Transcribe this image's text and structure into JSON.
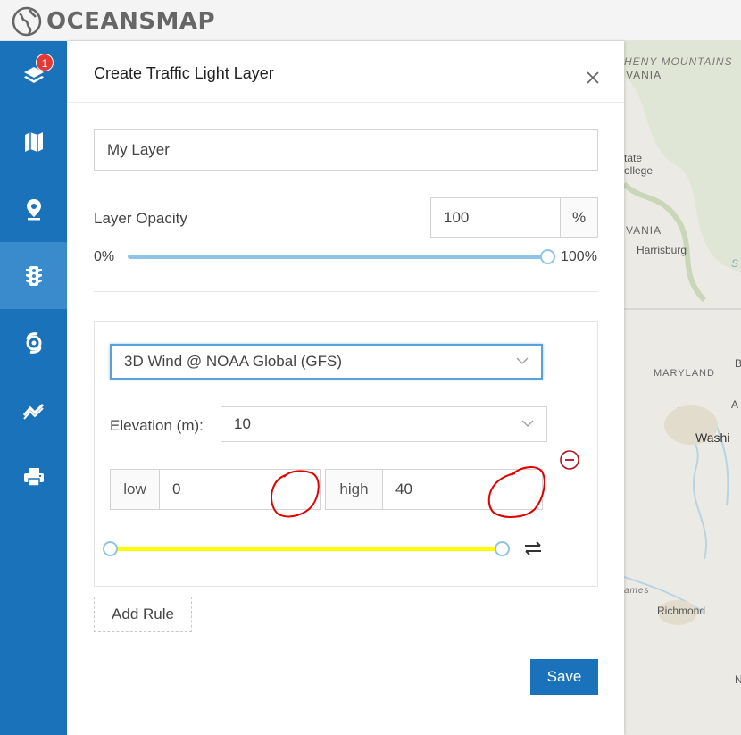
{
  "app": {
    "brand": "OCEANSMAP"
  },
  "sidebar": {
    "items": [
      {
        "icon": "layers-icon",
        "badge": "1"
      },
      {
        "icon": "map-icon"
      },
      {
        "icon": "location-pin-icon"
      },
      {
        "icon": "traffic-light-icon",
        "active": true
      },
      {
        "icon": "hurricane-icon"
      },
      {
        "icon": "trend-chart-icon"
      },
      {
        "icon": "print-icon"
      }
    ]
  },
  "panel": {
    "title": "Create Traffic Light Layer",
    "layer_name": "My Layer",
    "opacity": {
      "label": "Layer Opacity",
      "value": "100",
      "unit": "%",
      "min_label": "0%",
      "max_label": "100%",
      "slider_fraction": 1.0
    },
    "rule": {
      "dataset": "3D Wind @ NOAA Global (GFS)",
      "elevation_label": "Elevation (m):",
      "elevation_value": "10",
      "low_label": "low",
      "low_value": "0",
      "high_label": "high",
      "high_value": "40",
      "range_color": "#ffff00"
    },
    "add_rule_label": "Add Rule",
    "save_label": "Save"
  },
  "map": {
    "labels": [
      "HENY MOUNTAINS",
      "VANIA",
      "tate",
      "ollege",
      "VANIA",
      "Harrisburg",
      "MARYLAND",
      "B",
      "A",
      "Washi",
      "ames",
      "Richmond",
      "N",
      "S"
    ]
  },
  "colors": {
    "accent": "#1a72bb",
    "sidebar_active": "#3a8bcb",
    "badge": "#e53935",
    "slider_track": "#8ec5e6",
    "annotation": "#e00000"
  }
}
